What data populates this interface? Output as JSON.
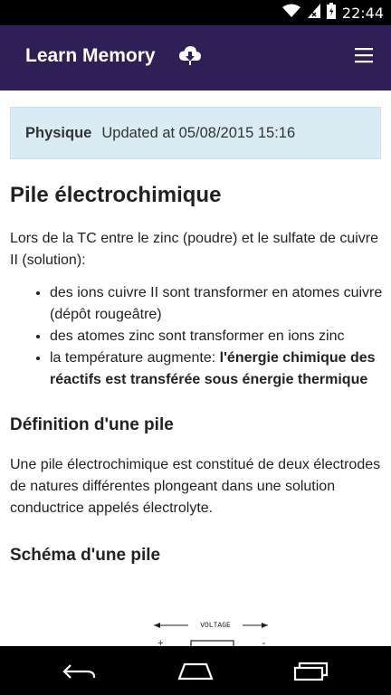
{
  "status_bar": {
    "time": "22:44",
    "icons": [
      "wifi-icon",
      "signal-icon",
      "battery-icon"
    ]
  },
  "app_bar": {
    "title": "Learn Memory",
    "sync_icon": "cloud-download-icon",
    "menu_icon": "hamburger-menu-icon",
    "background": "#2e1f57"
  },
  "category": {
    "name": "Physique",
    "updated": "Updated at 05/08/2015 15:16",
    "background": "#d9ecf3"
  },
  "article": {
    "title": "Pile électrochimique",
    "intro": "Lors de la TC entre le zinc (poudre) et le sulfate de cuivre II (solution):",
    "bullets": [
      "des ions cuivre II sont transformer en atomes cuivre (dépôt rougeâtre)",
      "des atomes zinc sont transformer en ions zinc",
      "la température augmente: "
    ],
    "bullet3_bold": "l'énergie chimique des réactifs est transférée sous énergie thermique",
    "section1_title": "Définition d'une pile",
    "section1_text": "Une pile électrochimique est constitué de deux électrodes de natures différentes plongeant dans une solution conductrice appelés électrolyte.",
    "section2_title": "Schéma d'une pile",
    "diagram": {
      "label": "VOLTAGE",
      "plus": "+",
      "minus": "-"
    }
  },
  "nav_bar": {
    "back_icon": "back-icon",
    "home_icon": "home-icon",
    "recents_icon": "recents-icon"
  }
}
